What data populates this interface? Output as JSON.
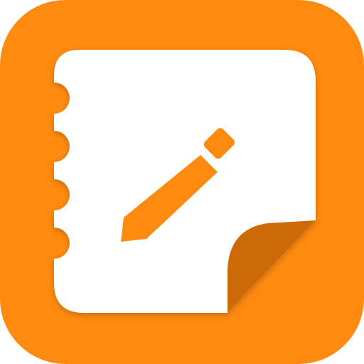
{
  "icon": {
    "name": "notepad-pencil-app-icon",
    "colors": {
      "background": "#FF8A0F",
      "paper": "#FFFFFF",
      "pencil": "#FF8A0F",
      "page_curl": "#CC6A08",
      "shadow": "#D97300"
    }
  }
}
